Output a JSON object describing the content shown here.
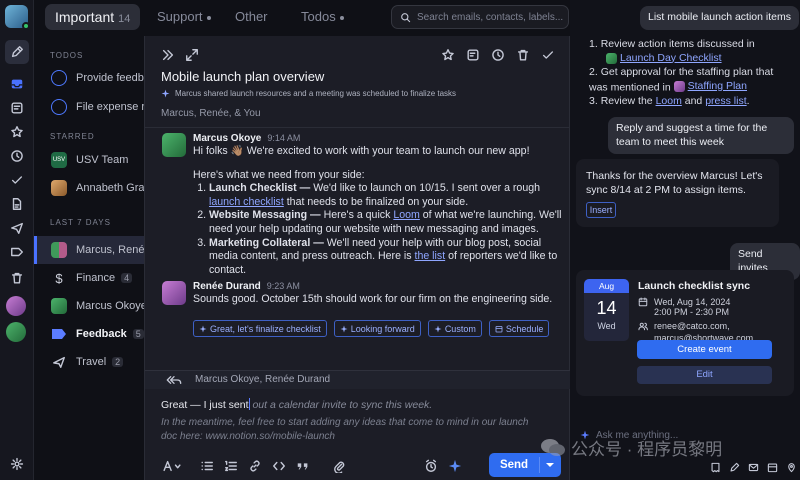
{
  "tabs": [
    {
      "label": "Important",
      "count": "14"
    },
    {
      "label": "Support"
    },
    {
      "label": "Other"
    },
    {
      "label": "Todos"
    }
  ],
  "search": {
    "placeholder": "Search emails, contacts, labels..."
  },
  "sidebar": {
    "todos_header": "TODOS",
    "todos": [
      "Provide feedback",
      "File expense report"
    ],
    "starred_header": "STARRED",
    "starred": [
      {
        "label": "USV Team",
        "avatar": "USV"
      },
      {
        "label": "Annabeth Gran"
      }
    ],
    "last7_header": "LAST 7 DAYS",
    "items": [
      {
        "label": "Marcus, Renée"
      },
      {
        "label": "Finance",
        "count": "4"
      },
      {
        "label": "Marcus Okoye"
      },
      {
        "label": "Feedback",
        "count": "5"
      },
      {
        "label": "Travel",
        "count": "2"
      }
    ]
  },
  "thread": {
    "subject": "Mobile launch plan overview",
    "summary": "Marcus shared launch resources and a meeting was scheduled to finalize tasks",
    "participants": "Marcus, Renée, & You",
    "messages": [
      {
        "sender": "Marcus Okoye",
        "time": "9:14 AM",
        "greeting": "Hi folks 👋🏽 We're excited to work with your team to launch our new app!",
        "intro": "Here's what we need from your side:",
        "items": [
          {
            "title": "Launch Checklist —",
            "pre": " We'd like to launch on 10/15. I sent over a rough ",
            "link": "launch checklist",
            "post": " that needs to be finalized on your side."
          },
          {
            "title": "Website Messaging —",
            "pre": " Here's a quick ",
            "link": "Loom",
            "post": " of what we're launching. We'll need your help updating our website with new messaging and images."
          },
          {
            "title": "Marketing Collateral —",
            "pre": " We'll need your help with our blog post, social media content, and press outreach. Here is ",
            "link": "the list",
            "post": " of reporters we'd like to contact."
          }
        ]
      },
      {
        "sender": "Renée Durand",
        "time": "9:23 AM",
        "text": "Sounds good. October 15th should work for our firm on the engineering side."
      }
    ],
    "suggestions": [
      "Great, let's finalize checklist",
      "Looking forward",
      "Custom",
      "Schedule"
    ],
    "reply_to": "Marcus Okoye, Renée Durand",
    "compose_typed": "Great — I just sent",
    "compose_ghost": " out a calendar invite to sync this week.",
    "compose_ghost2": "In the meantime, feel free to start adding any ideas that come to mind in our launch doc here: www.notion.so/mobile-launch",
    "send_label": "Send"
  },
  "assistant": {
    "user_msg1": "List mobile launch action items",
    "resp1": {
      "line1_pre": "Review action items discussed in",
      "line1_chip": "Launch Day Checklist",
      "line2_pre": "Get approval for the staffing plan that was mentioned in",
      "line2_chip": "Staffing Plan",
      "line3_pre": "Review the",
      "line3_link1": "Loom",
      "line3_and": "and",
      "line3_link2": "press list",
      "line3_end": "."
    },
    "user_msg2": "Reply and suggest a time for the team to meet this week",
    "resp2": {
      "text": "Thanks for the overview Marcus! Let's sync 8/14 at 2 PM to assign items.",
      "insert": "Insert"
    },
    "user_msg3": "Send invites",
    "event": {
      "month": "Aug",
      "day": "14",
      "weekday": "Wed",
      "title": "Launch checklist sync",
      "date": "Wed, Aug 14, 2024",
      "time": "2:00 PM - 2:30 PM",
      "attendees": "renee@catco.com, marcus@shortwave.com",
      "create": "Create event",
      "edit": "Edit"
    },
    "ask_placeholder": "Ask me anything..."
  },
  "watermark": "公众号 · 程序员黎明"
}
